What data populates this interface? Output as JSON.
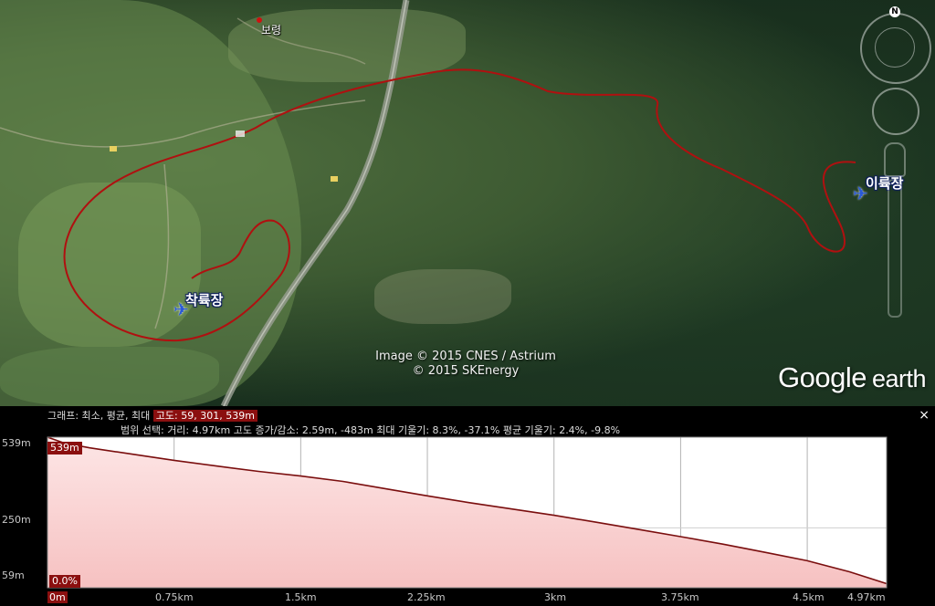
{
  "map": {
    "places": [
      {
        "label": "착륙장"
      },
      {
        "label": "이륙장"
      },
      {
        "label": "보령"
      }
    ],
    "attribution_line1": "Image © 2015 CNES / Astrium",
    "attribution_line2": "© 2015 SKEnergy",
    "logo_google": "Google",
    "logo_earth": "earth",
    "compass_label": "N",
    "route_color": "#b01010"
  },
  "profile": {
    "header_line1_prefix": "그래프: 최소, 평균, 최대",
    "header_line1_value": "고도: 59, 301, 539m",
    "header_line2_prefix": "범위 선택:",
    "header_line2_distance": "거리: 4.97km",
    "header_line2_gain": "고도 증가/감소: 2.59m, -483m",
    "header_line2_maxslope": "최대 기울기: 8.3%, -37.1%",
    "header_line2_avgslope": "평균 기울기: 2.4%, -9.8%",
    "close_label": "×",
    "y_labels": [
      "539m",
      "250m",
      "59m"
    ],
    "x_labels": [
      "0m",
      "0.75km",
      "1.5km",
      "2.25km",
      "3km",
      "3.75km",
      "4.5km",
      "4.97km"
    ],
    "start_badge": "539m",
    "slope_badge": "0.0%",
    "fill_color": "#f6c1c1",
    "line_color": "#7a0e0e"
  },
  "chart_data": {
    "type": "area",
    "title": "",
    "xlabel": "",
    "ylabel": "",
    "x_unit": "km",
    "y_unit": "m",
    "xlim": [
      0,
      4.97
    ],
    "ylim": [
      59,
      539
    ],
    "x": [
      0,
      0.1,
      0.25,
      0.5,
      0.75,
      1.0,
      1.25,
      1.5,
      1.75,
      2.0,
      2.25,
      2.5,
      2.75,
      3.0,
      3.25,
      3.5,
      3.75,
      4.0,
      4.25,
      4.5,
      4.75,
      4.97
    ],
    "series": [
      {
        "values": [
          539,
          520,
          505,
          485,
          465,
          447,
          430,
          415,
          398,
          375,
          352,
          330,
          310,
          290,
          268,
          245,
          222,
          198,
          172,
          145,
          110,
          72
        ]
      }
    ]
  }
}
